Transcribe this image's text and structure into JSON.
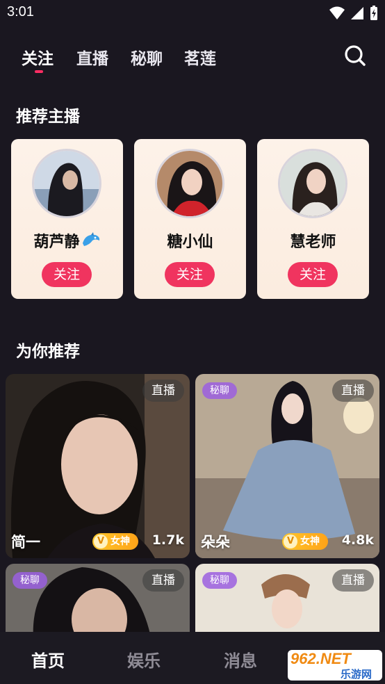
{
  "status_bar": {
    "time": "3:01"
  },
  "top_tabs": [
    {
      "label": "关注"
    },
    {
      "label": "直播"
    },
    {
      "label": "秘聊"
    },
    {
      "label": "茗莲"
    }
  ],
  "recommended_anchors": {
    "title": "推荐主播",
    "items": [
      {
        "name": "葫芦静",
        "follow_label": "关注"
      },
      {
        "name": "糖小仙",
        "follow_label": "关注"
      },
      {
        "name": "慧老师",
        "follow_label": "关注"
      }
    ]
  },
  "for_you": {
    "title": "为你推荐",
    "cards": [
      {
        "name": "简一",
        "live_label": "直播",
        "goddess_label": "女神",
        "goddess_v": "V",
        "views": "1.7k"
      },
      {
        "name": "朵朵",
        "live_label": "直播",
        "secret_label": "秘聊",
        "goddess_label": "女神",
        "goddess_v": "V",
        "views": "4.8k"
      },
      {
        "live_label": "直播",
        "secret_label": "秘聊"
      },
      {
        "live_label": "直播",
        "secret_label": "秘聊"
      }
    ]
  },
  "bottom_nav": [
    {
      "label": "首页"
    },
    {
      "label": "娱乐"
    },
    {
      "label": "消息"
    }
  ],
  "watermark": {
    "top": "962.NET",
    "bottom": "乐游网"
  },
  "colors": {
    "accent": "#f0345f",
    "background": "#1a1720",
    "card": "#fdf2e9",
    "goddess": "#ffb320",
    "secret_badge": "#9b5fe1"
  }
}
